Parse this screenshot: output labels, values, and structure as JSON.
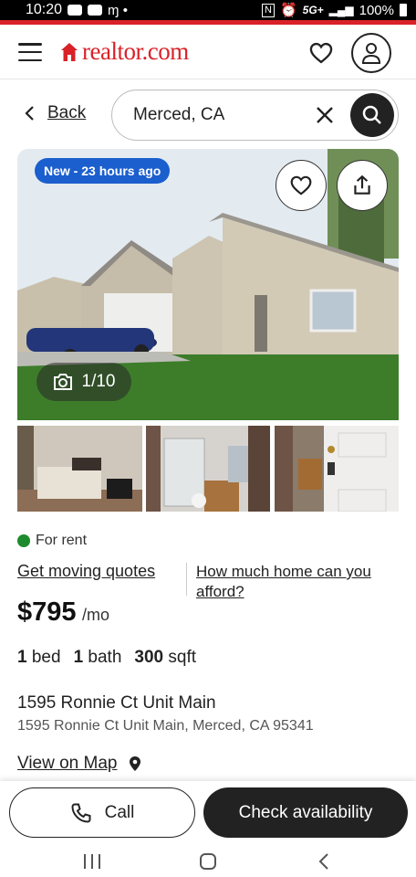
{
  "status_bar": {
    "time": "10:20",
    "network": "5G+",
    "battery": "100%"
  },
  "header": {
    "logo_text": "realtor.com",
    "brand_color": "#d92228"
  },
  "search": {
    "back_label": "Back",
    "query": "Merced, CA"
  },
  "gallery": {
    "badge": "New - 23 hours ago",
    "photo_counter": "1/10",
    "thumbnails": [
      "bedroom-photo",
      "bathroom-photo",
      "door-photo"
    ]
  },
  "listing": {
    "status": "For rent",
    "moving_link": "Get moving quotes",
    "afford_link": "How much home can you afford?",
    "price": "$795",
    "price_unit": "/mo",
    "beds_num": "1",
    "beds_label": "bed",
    "baths_num": "1",
    "baths_label": "bath",
    "sqft_num": "300",
    "sqft_label": "sqft",
    "address_line": "1595 Ronnie Ct Unit Main",
    "full_address": "1595 Ronnie Ct Unit Main, Merced, CA 95341",
    "map_link": "View on Map"
  },
  "actions": {
    "call_label": "Call",
    "check_label": "Check availability"
  },
  "colors": {
    "accent_blue": "#1b5fce",
    "status_green": "#1e8a2e",
    "dark": "#222222"
  }
}
